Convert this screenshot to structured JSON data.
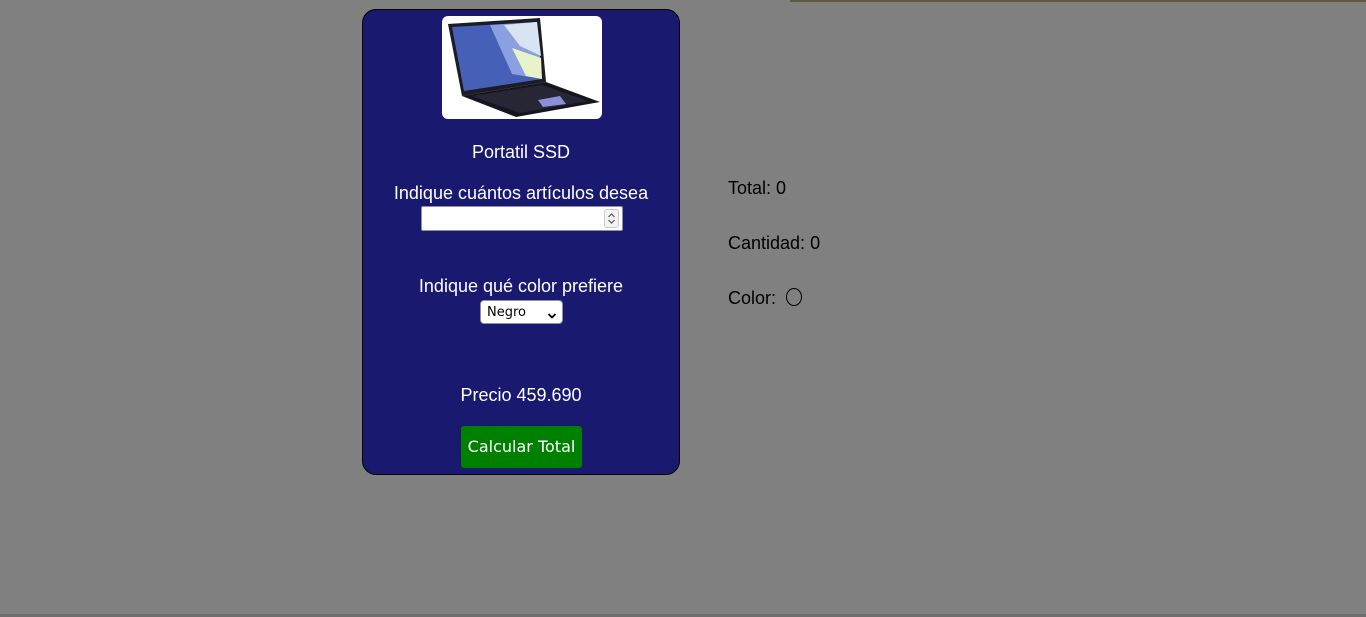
{
  "product": {
    "image_alt": "laptop",
    "name": "Portatil SSD",
    "quantity_label": "Indique cuántos artículos desea",
    "quantity_value": "",
    "color_label": "Indique qué color prefiere",
    "color_selected": "Negro",
    "price_text": "Precio 459.690",
    "button_label": "Calcular Total"
  },
  "summary": {
    "total_label": "Total:",
    "total_value": "0",
    "quantity_label": "Cantidad:",
    "quantity_value": "0",
    "color_label": "Color:"
  },
  "colors": {
    "background": "#808080",
    "card": "#191970",
    "button": "#008000"
  }
}
